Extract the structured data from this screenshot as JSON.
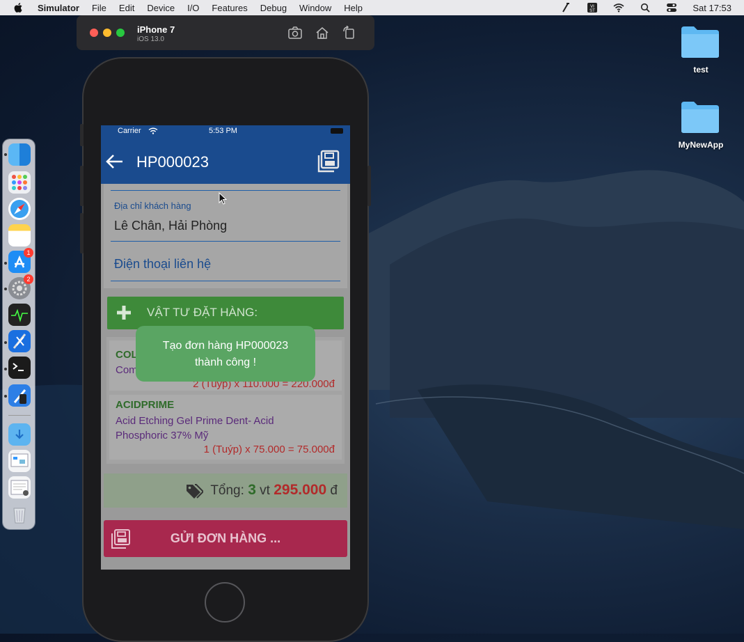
{
  "menubar": {
    "app_name": "Simulator",
    "items": [
      "File",
      "Edit",
      "Device",
      "I/O",
      "Features",
      "Debug",
      "Window",
      "Help"
    ],
    "clock": "Sat 17:53"
  },
  "simulator": {
    "device_name": "iPhone 7",
    "os_version": "iOS 13.0"
  },
  "desktop": {
    "folders": [
      {
        "label": "test"
      },
      {
        "label": "MyNewApp"
      }
    ]
  },
  "dock": {
    "badges": {
      "app_store": "1",
      "system_prefs": "2"
    }
  },
  "app": {
    "status": {
      "carrier": "Carrier",
      "time": "5:53 PM"
    },
    "nav": {
      "title": "HP000023"
    },
    "form": {
      "address_label": "Địa chỉ khách hàng",
      "address_value": "Lê Chân, Hải Phòng",
      "phone_placeholder": "Điện thoại liên hệ"
    },
    "add_items_label": "VẬT TƯ ĐẶT HÀNG:",
    "items": [
      {
        "code": "COL",
        "name": "Com",
        "qty": "2 (Tuýp) x 110.000 = 220.000đ"
      },
      {
        "code": "ACIDPRIME",
        "name": "Acid Etching Gel Prime Dent- Acid Phosphoric 37% Mỹ",
        "qty": "1 (Tuýp) x 75.000 = 75.000đ"
      }
    ],
    "total": {
      "label": "Tổng:",
      "count": "3",
      "count_unit": "vt",
      "amount": "295.000",
      "currency": "đ"
    },
    "send_label": "GỬI ĐƠN HÀNG ...",
    "toast": {
      "line1": "Tạo đơn hàng HP000023",
      "line2": "thành công !"
    }
  },
  "colors": {
    "nav_blue": "#1a4b8e",
    "green": "#3e8a3a",
    "send_red": "#a8284e",
    "toast_green": "#5aa563"
  }
}
